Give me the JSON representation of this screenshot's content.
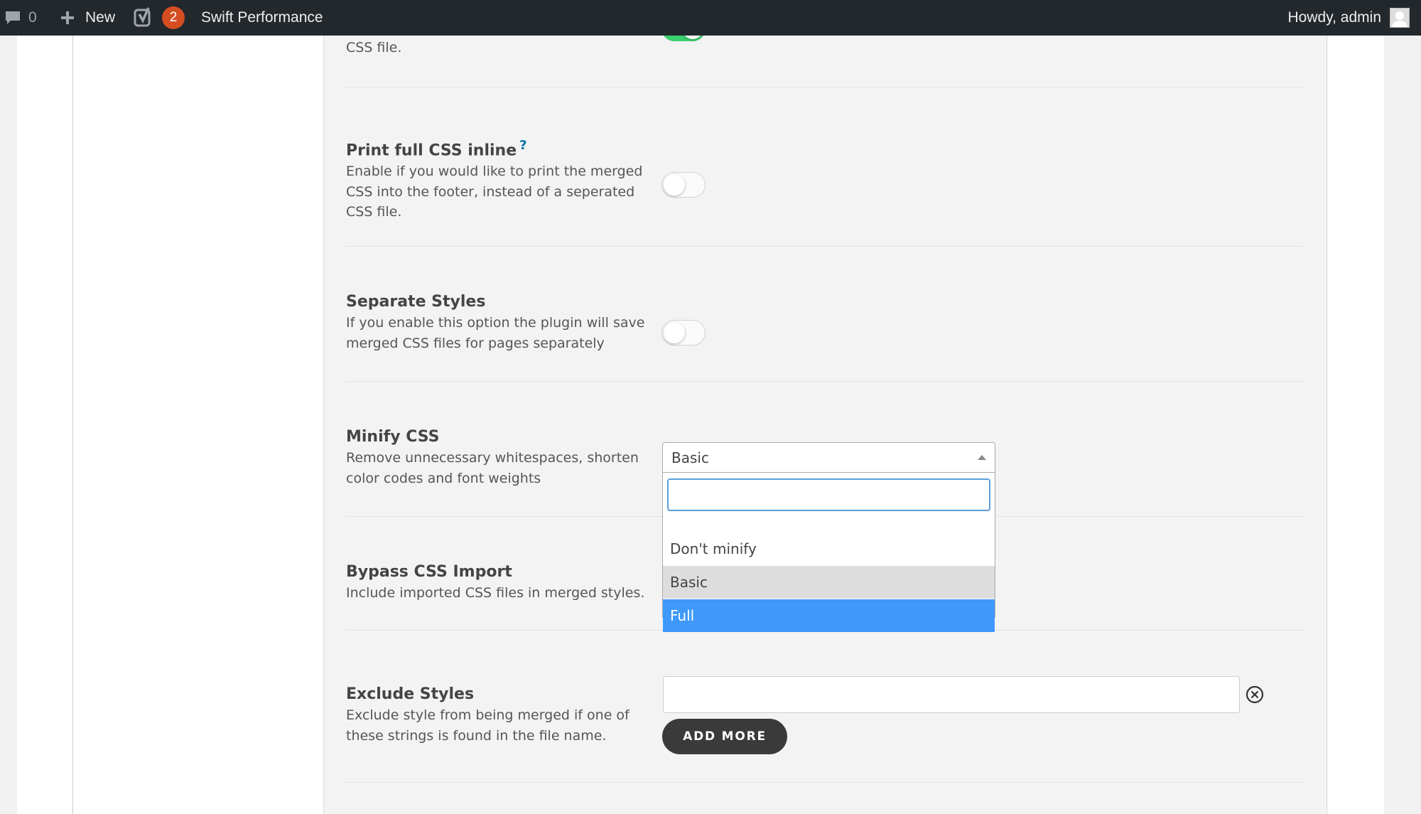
{
  "adminbar": {
    "comments_count": "0",
    "new_label": "New",
    "yoast_badge": "2",
    "site_name": "Swift Performance",
    "howdy": "Howdy, admin"
  },
  "settings": {
    "top_partial_desc": "CSS file.",
    "print_full_css": {
      "title": "Print full CSS inline",
      "help": "?",
      "desc": "Enable if you would like to print the merged CSS into the footer, instead of a seperated CSS file.",
      "enabled": false
    },
    "separate_styles": {
      "title": "Separate Styles",
      "desc": "If you enable this option the plugin will save merged CSS files for pages separately",
      "enabled": false
    },
    "minify_css": {
      "title": "Minify CSS",
      "desc": "Remove unnecessary whitespaces, shorten color codes and font weights",
      "selected": "Basic",
      "search_value": "",
      "options": [
        "Don't minify",
        "Basic",
        "Full"
      ],
      "highlighted": "Full"
    },
    "bypass_css_import": {
      "title": "Bypass CSS Import",
      "desc": "Include imported CSS files in merged styles."
    },
    "exclude_styles": {
      "title": "Exclude Styles",
      "desc": "Exclude style from being merged if one of these strings is found in the file name.",
      "input_value": "",
      "add_more_label": "ADD MORE"
    }
  },
  "colors": {
    "adminbar_bg": "#23282d",
    "toggle_on": "#3bd16f",
    "highlight": "#3e99fb",
    "help_link": "#0073aa",
    "yoast_badge": "#d54e21"
  }
}
